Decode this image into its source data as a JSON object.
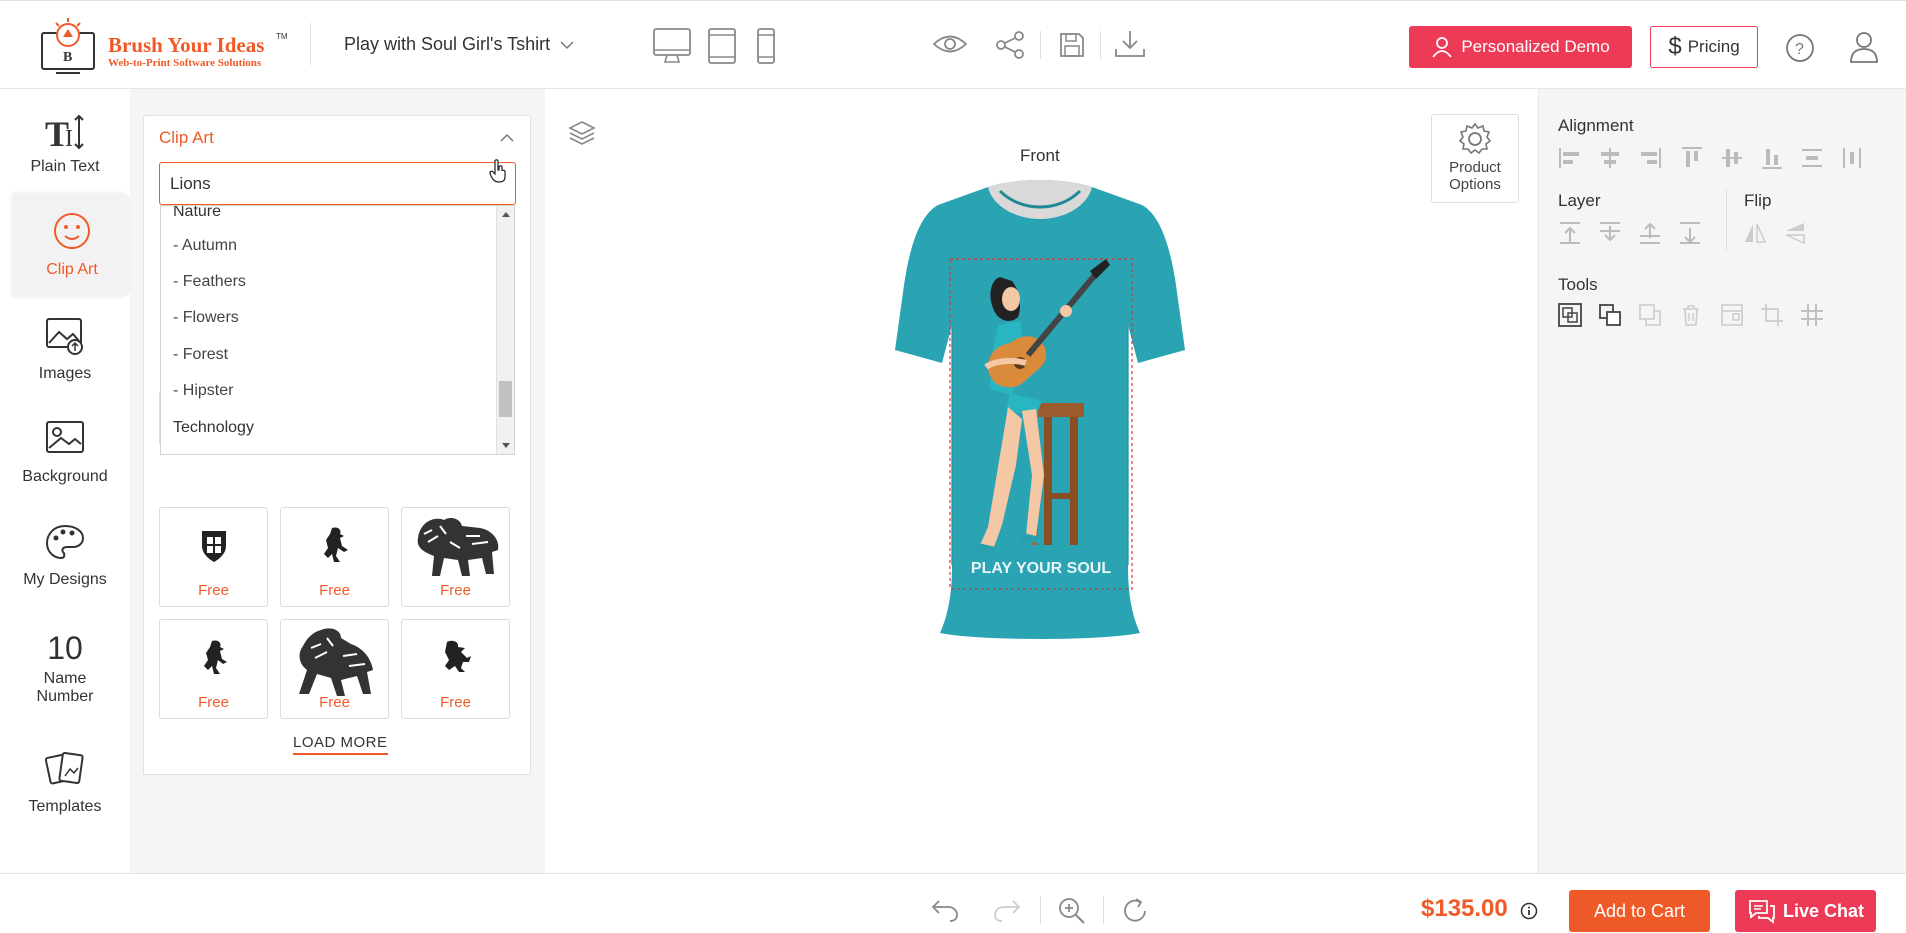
{
  "header": {
    "logo_title": "Brush Your Ideas",
    "logo_tm": "TM",
    "logo_subtitle": "Web-to-Print Software Solutions",
    "product_title": "Play with Soul Girl's Tshirt",
    "demo_label": "Personalized Demo",
    "pricing_label": "Pricing"
  },
  "leftnav": {
    "items": [
      {
        "label": "Plain Text",
        "icon": "text-icon"
      },
      {
        "label": "Clip Art",
        "icon": "clipart-icon"
      },
      {
        "label": "Images",
        "icon": "image-upload-icon"
      },
      {
        "label": "Background",
        "icon": "background-icon"
      },
      {
        "label": "My Designs",
        "icon": "palette-icon"
      },
      {
        "label": "Name Number",
        "icon_text": "10"
      },
      {
        "label": "Templates",
        "icon": "templates-icon"
      }
    ]
  },
  "clipart_panel": {
    "title": "Clip Art",
    "selected_category": "Lions",
    "dropdown_options": [
      "Nature",
      "- Autumn",
      "- Feathers",
      "- Flowers",
      "- Forest",
      "- Hipster",
      "Technology"
    ],
    "grid_badge": "Free",
    "load_more_label": "LOAD MORE"
  },
  "canvas": {
    "side_label": "Front",
    "shirt_text": "PLAY YOUR SOUL",
    "product_options_label_1": "Product",
    "product_options_label_2": "Options"
  },
  "rightpanel": {
    "alignment_title": "Alignment",
    "layer_title": "Layer",
    "flip_title": "Flip",
    "tools_title": "Tools"
  },
  "footer": {
    "price": "$135.00",
    "add_to_cart_label": "Add to Cart",
    "live_chat_label": "Live Chat"
  },
  "colors": {
    "accent_orange": "#f05a28",
    "accent_pink": "#ec3a57",
    "shirt_teal": "#2aa3b3"
  }
}
